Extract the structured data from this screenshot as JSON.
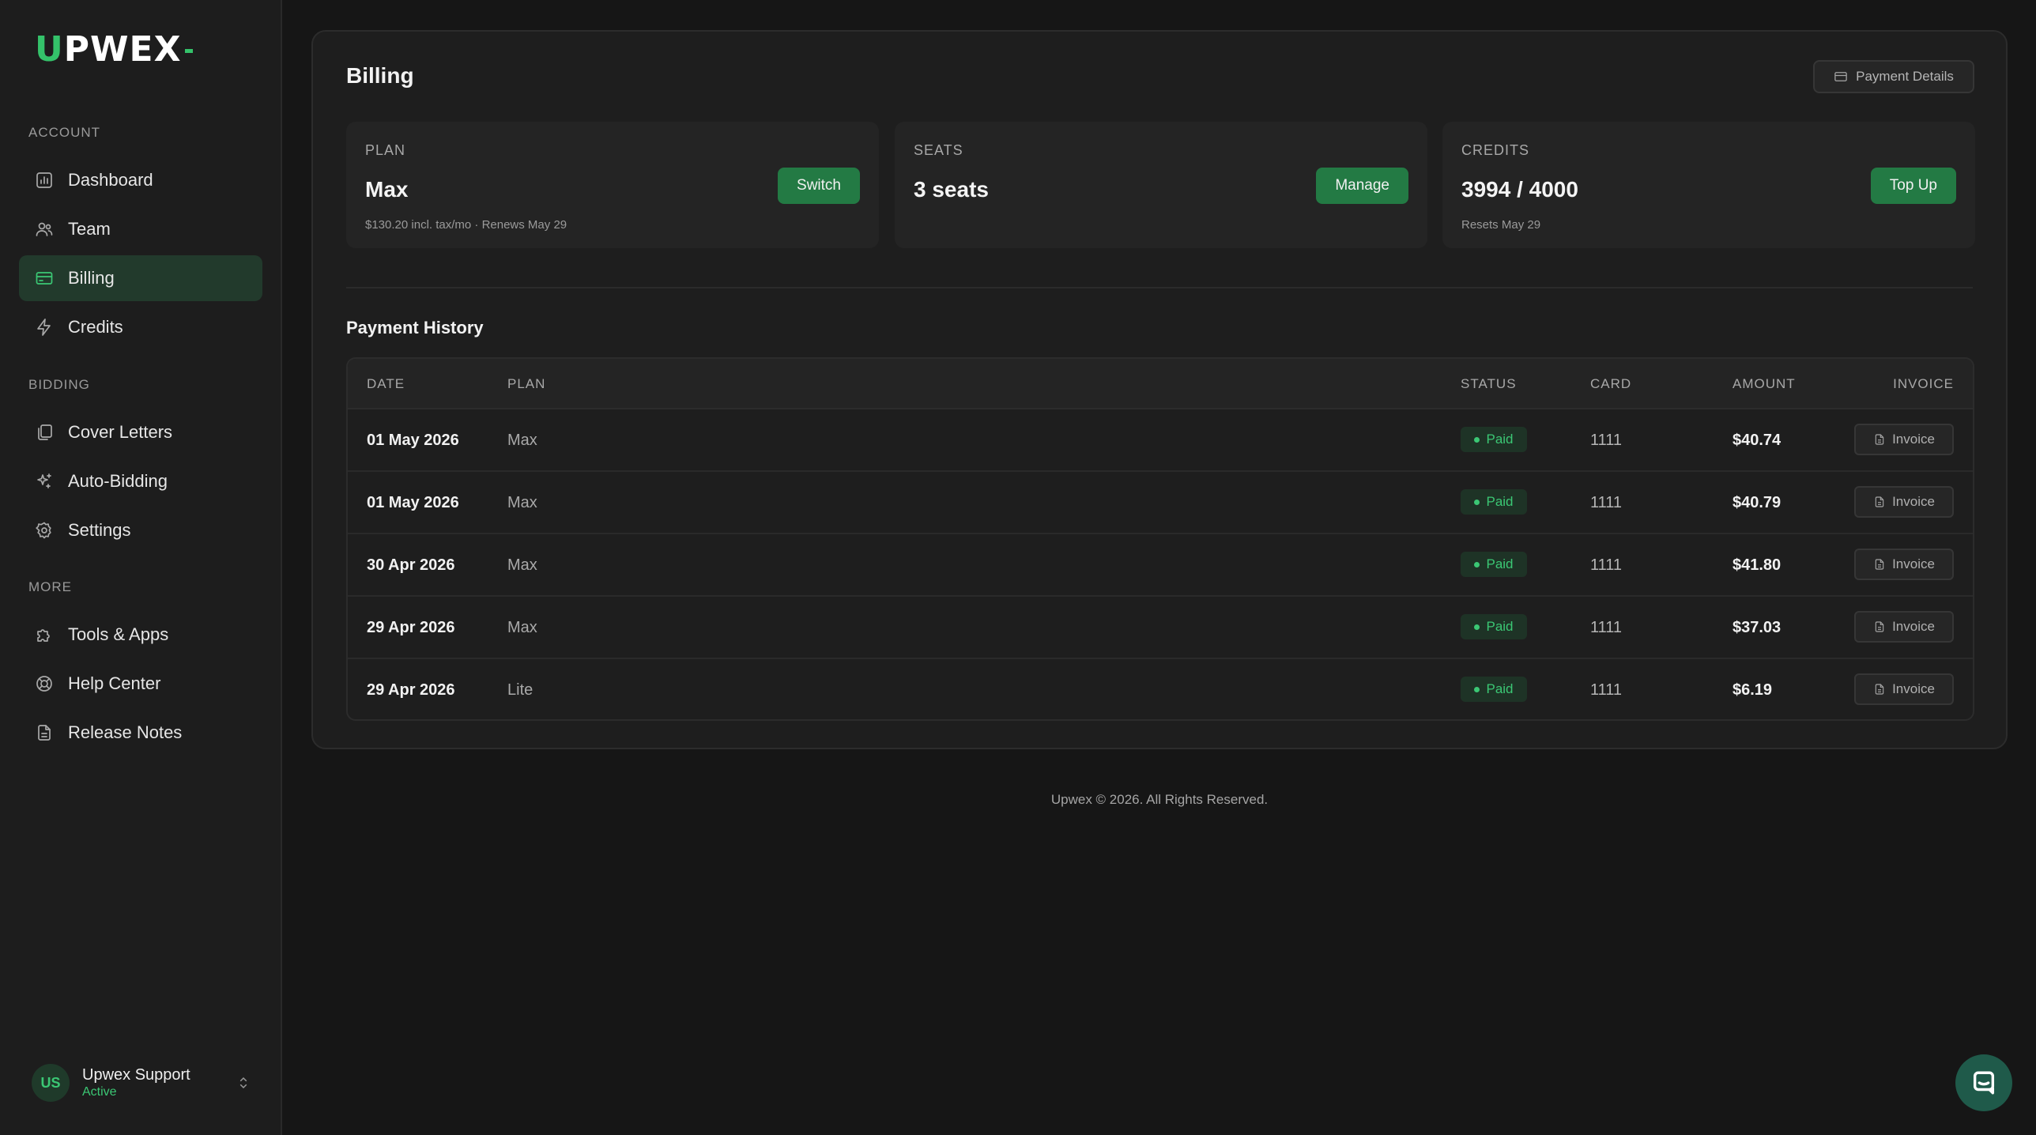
{
  "brand": {
    "logo_text": "UPWEX",
    "accent": "#34c26a"
  },
  "sidebar": {
    "sections": [
      {
        "label": "ACCOUNT"
      },
      {
        "label": "BIDDING"
      },
      {
        "label": "MORE"
      }
    ],
    "items": [
      {
        "label": "Dashboard",
        "icon": "chart-icon"
      },
      {
        "label": "Team",
        "icon": "users-icon"
      },
      {
        "label": "Billing",
        "icon": "credit-card-icon",
        "active": true
      },
      {
        "label": "Credits",
        "icon": "bolt-icon"
      },
      {
        "label": "Cover Letters",
        "icon": "copy-icon"
      },
      {
        "label": "Auto-Bidding",
        "icon": "sparkles-icon"
      },
      {
        "label": "Settings",
        "icon": "gear-icon"
      },
      {
        "label": "Tools & Apps",
        "icon": "puzzle-icon"
      },
      {
        "label": "Help Center",
        "icon": "lifebuoy-icon"
      },
      {
        "label": "Release Notes",
        "icon": "document-icon"
      }
    ],
    "user": {
      "initials": "US",
      "name": "Upwex Support",
      "status": "Active"
    }
  },
  "main": {
    "title": "Billing",
    "payment_details_label": "Payment Details",
    "cards": [
      {
        "label": "PLAN",
        "value": "Max",
        "sub": "$130.20 incl. tax/mo · Renews May 29",
        "button": "Switch"
      },
      {
        "label": "SEATS",
        "value": "3 seats",
        "sub": "",
        "button": "Manage"
      },
      {
        "label": "CREDITS",
        "value": "3994 / 4000",
        "sub": "Resets May 29",
        "button": "Top Up"
      }
    ],
    "history": {
      "title": "Payment History",
      "columns": [
        "DATE",
        "PLAN",
        "STATUS",
        "CARD",
        "AMOUNT",
        "INVOICE"
      ],
      "rows": [
        {
          "date": "01 May 2026",
          "plan": "Max",
          "status": "Paid",
          "card": "1111",
          "amount": "$40.74",
          "invoice": "Invoice"
        },
        {
          "date": "01 May 2026",
          "plan": "Max",
          "status": "Paid",
          "card": "1111",
          "amount": "$40.79",
          "invoice": "Invoice"
        },
        {
          "date": "30 Apr 2026",
          "plan": "Max",
          "status": "Paid",
          "card": "1111",
          "amount": "$41.80",
          "invoice": "Invoice"
        },
        {
          "date": "29 Apr 2026",
          "plan": "Max",
          "status": "Paid",
          "card": "1111",
          "amount": "$37.03",
          "invoice": "Invoice"
        },
        {
          "date": "29 Apr 2026",
          "plan": "Lite",
          "status": "Paid",
          "card": "1111",
          "amount": "$6.19",
          "invoice": "Invoice"
        }
      ]
    }
  },
  "footer": {
    "text": "Upwex © 2026. All Rights Reserved."
  },
  "colors": {
    "background": "#161616",
    "sidebar": "#1d1d1d",
    "panel": "#1e1e1e",
    "accent_green": "#237a44",
    "status_green": "#3bc774"
  }
}
